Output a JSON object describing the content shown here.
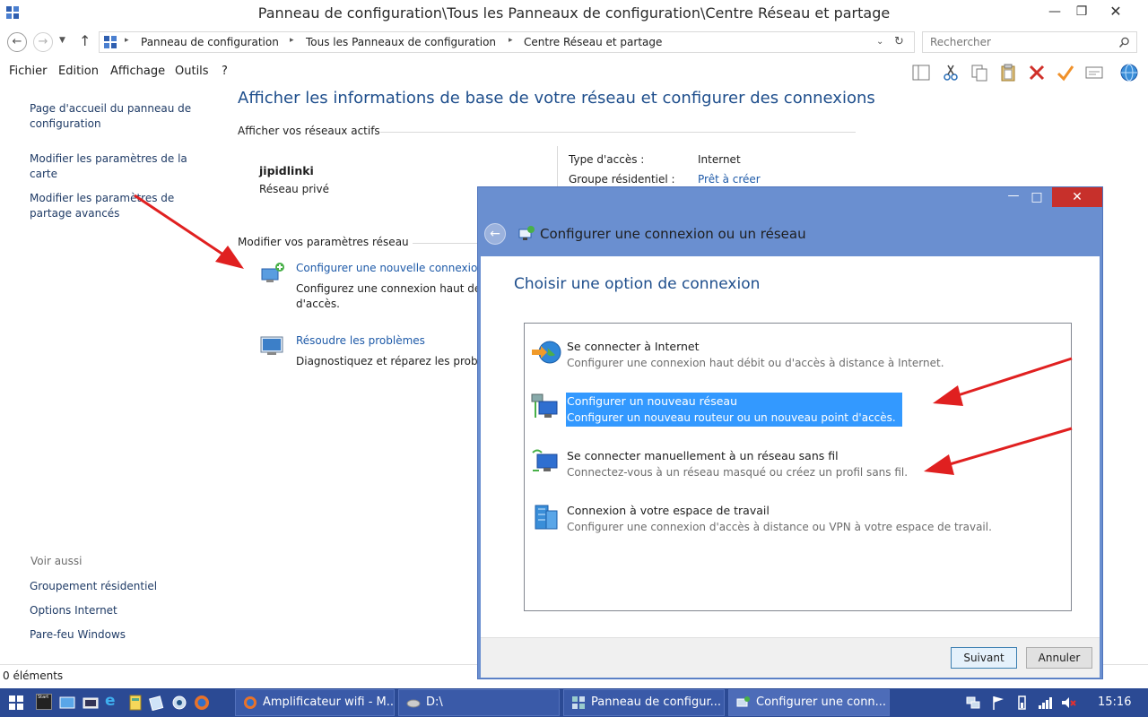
{
  "window": {
    "title": "Panneau de configuration\\Tous les Panneaux de configuration\\Centre Réseau et partage"
  },
  "address": {
    "crumbs": [
      "Panneau de configuration",
      "Tous les Panneaux de configuration",
      "Centre Réseau et partage"
    ],
    "search_placeholder": "Rechercher"
  },
  "menu": [
    "Fichier",
    "Edition",
    "Affichage",
    "Outils",
    "?"
  ],
  "sidebar": {
    "links": [
      "Page d'accueil du panneau de configuration",
      "Modifier les paramètres de la carte",
      "Modifier les paramètres de partage avancés"
    ],
    "see_also_label": "Voir aussi",
    "see_also": [
      "Groupement résidentiel",
      "Options Internet",
      "Pare-feu Windows"
    ]
  },
  "main": {
    "heading": "Afficher les informations de base de votre réseau et configurer des connexions",
    "active_networks_label": "Afficher vos réseaux actifs",
    "network_name": "jipidlinki",
    "network_type": "Réseau privé",
    "access_type_label": "Type d'accès :",
    "access_type_value": "Internet",
    "homegroup_label": "Groupe résidentiel :",
    "homegroup_value": "Prêt à créer",
    "modify_label": "Modifier vos paramètres réseau",
    "task1_link": "Configurer une nouvelle connexion",
    "task1_desc_line1": "Configurez une connexion haut déb",
    "task1_desc_line2": "d'accès.",
    "task2_link": "Résoudre les problèmes",
    "task2_desc": "Diagnostiquez et réparez les probl"
  },
  "status": {
    "items": "0 éléments"
  },
  "dialog": {
    "title": "Configurer une connexion ou un réseau",
    "heading": "Choisir une option de connexion",
    "options": [
      {
        "title": "Se connecter à Internet",
        "desc": "Configurer une connexion haut débit ou d'accès à distance à Internet."
      },
      {
        "title": "Configurer un nouveau réseau",
        "desc": "Configurer un nouveau routeur ou un nouveau point d'accès."
      },
      {
        "title": "Se connecter manuellement à un réseau sans fil",
        "desc": "Connectez-vous à un réseau masqué ou créez un profil sans fil."
      },
      {
        "title": "Connexion à votre espace de travail",
        "desc": "Configurer une connexion d'accès à distance ou VPN à votre espace de travail."
      }
    ],
    "selected_index": 1,
    "next_label": "Suivant",
    "cancel_label": "Annuler"
  },
  "taskbar": {
    "start_label": "Start",
    "tasks": [
      "Amplificateur wifi - M...",
      "D:\\",
      "Panneau de configur...",
      "Configurer une conn..."
    ],
    "clock": "15:16"
  },
  "colors": {
    "heading_blue": "#1e4e8c",
    "link_blue": "#1e5aa8",
    "dialog_frame": "#6a8fd0",
    "selection": "#3399ff",
    "taskbar": "#2b4a94",
    "close_red": "#c7302b",
    "arrow_red": "#e02020"
  }
}
